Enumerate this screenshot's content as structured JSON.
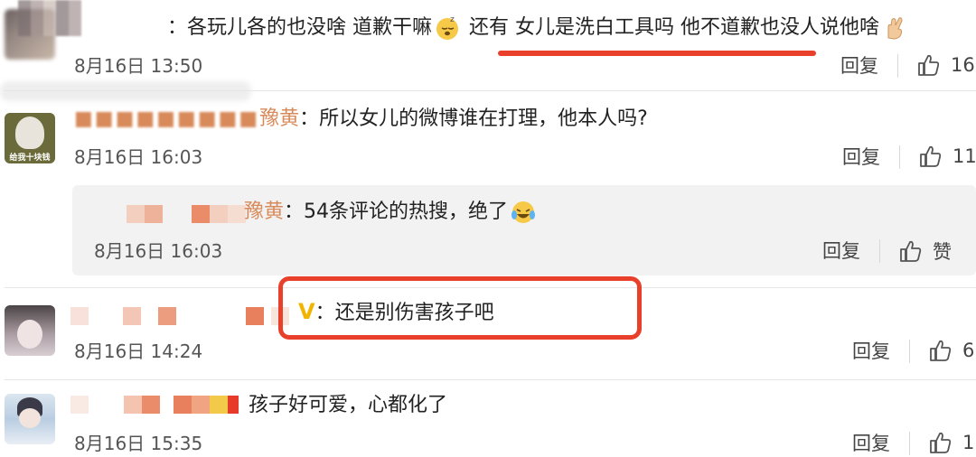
{
  "comments": [
    {
      "text": "：各玩儿各的也没啥 道歉干嘛",
      "text_after": "还有 女儿是洗白工具吗 他不道歉也没人说他啥",
      "time": "8月16日 13:50",
      "reply_label": "回复",
      "likes": "16"
    },
    {
      "name_partial": "豫黄",
      "text": "：所以女儿的微博谁在打理，他本人吗?",
      "time": "8月16日 16:03",
      "reply_label": "回复",
      "likes": "11"
    },
    {
      "nested": true,
      "name_partial": "豫黄",
      "text": "：54条评论的热搜，绝了",
      "time": "8月16日 16:03",
      "reply_label": "回复",
      "likes": "赞"
    },
    {
      "verified_badge": "V",
      "text": "：还是别伤害孩子吧",
      "time": "8月16日 14:24",
      "reply_label": "回复",
      "likes": "6"
    },
    {
      "text": "孩子好可爱，心都化了",
      "time": "8月16日 15:35",
      "reply_label": "回复",
      "likes": "1"
    }
  ],
  "colors": {
    "highlight_red": "#e8402a",
    "verified_gold": "#f2b400",
    "nested_bg": "#f2f2f2",
    "blurred_name": "#d88a5a"
  },
  "avatar_labels": {
    "comment_2": "给我十块钱"
  }
}
